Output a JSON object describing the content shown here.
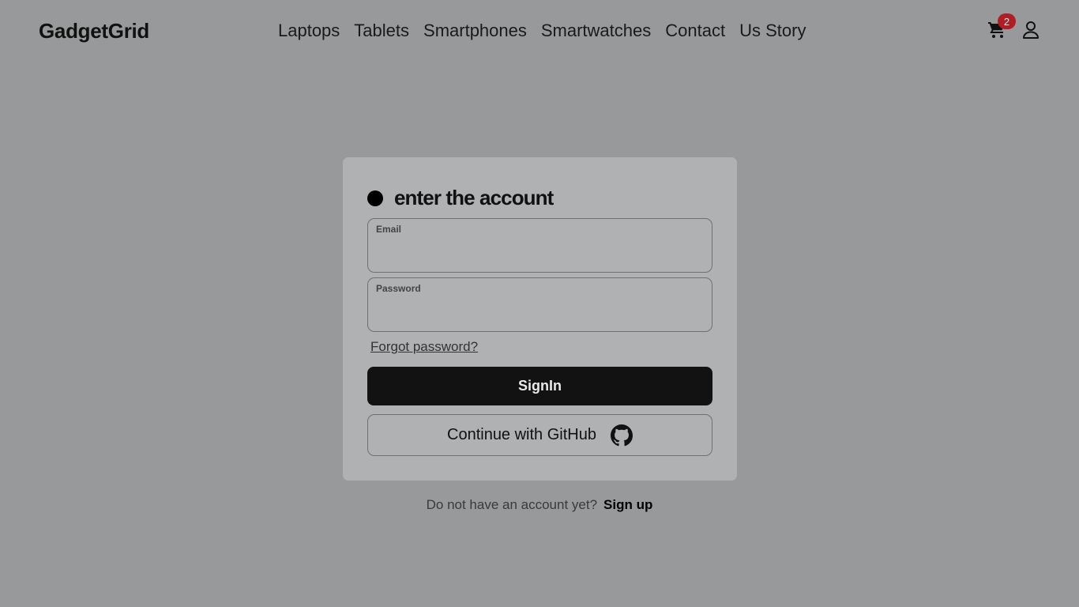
{
  "header": {
    "logo": "GadgetGrid",
    "nav": [
      {
        "label": "Laptops"
      },
      {
        "label": "Tablets"
      },
      {
        "label": "Smartphones"
      },
      {
        "label": "Smartwatches"
      },
      {
        "label": "Contact"
      },
      {
        "label": "Us Story"
      }
    ],
    "cart_icon": "cart-icon",
    "cart_count": "2",
    "user_icon": "user-icon"
  },
  "login": {
    "title": "enter the account",
    "email_label": "Email",
    "email_value": "",
    "password_label": "Password",
    "password_value": "",
    "forgot_label": "Forgot password?",
    "signin_label": "SignIn",
    "github_label": "Continue with GitHub",
    "github_icon": "github-icon"
  },
  "footer": {
    "prompt": "Do not have an account yet?",
    "signup_label": "Sign up"
  },
  "colors": {
    "background": "#98999a",
    "card": "#b0b1b3",
    "primary_button": "#121212",
    "badge": "#b11d24"
  }
}
